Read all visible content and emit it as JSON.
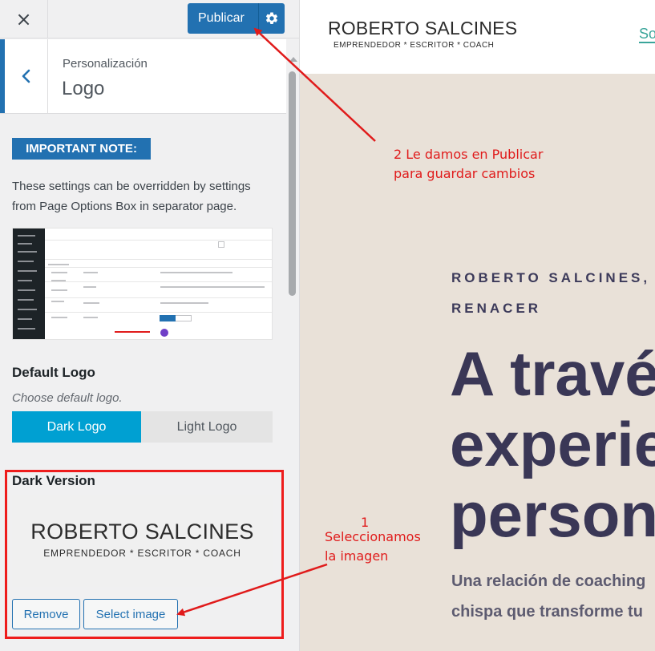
{
  "customizer": {
    "close_icon": "×",
    "publish_label": "Publicar",
    "breadcrumb": "Personalización",
    "section_title": "Logo",
    "note_badge": "IMPORTANT NOTE:",
    "note_text": "These settings can be overridden by settings from Page Options Box in separator page.",
    "default_logo_heading": "Default Logo",
    "default_logo_description": "Choose default logo.",
    "toggle": {
      "dark": "Dark Logo",
      "light": "Light Logo",
      "selected": "Dark Logo"
    },
    "dark_version_heading": "Dark Version",
    "logo_preview": {
      "name": "ROBERTO SALCINES",
      "tagline": "EMPRENDEDOR * ESCRITOR * COACH"
    },
    "remove_label": "Remove",
    "select_image_label": "Select image"
  },
  "preview": {
    "site_name": "ROBERTO SALCINES",
    "site_tagline": "EMPRENDEDOR * ESCRITOR * COACH",
    "nav_link": "So",
    "eyebrow_line1": "ROBERTO SALCINES,",
    "eyebrow_line2": "RENACER",
    "headline_line1": "A travé",
    "headline_line2": "experie",
    "headline_line3": "person",
    "lead_line1": "Una relación de coaching",
    "lead_line2": "chispa que transforme tu"
  },
  "annotations": {
    "publish_line1": "2 Le damos en Publicar",
    "publish_line2": "para guardar cambios",
    "select_number": "1",
    "select_line1": "Seleccionamos",
    "select_line2": "la imagen"
  },
  "colors": {
    "wp_blue": "#2271b1",
    "toggle_active": "#00a0d2",
    "annotation_red": "#e01b1b",
    "preview_bg": "#e9e1d8",
    "headline": "#3a3756",
    "nav_accent": "#3aa59a"
  }
}
